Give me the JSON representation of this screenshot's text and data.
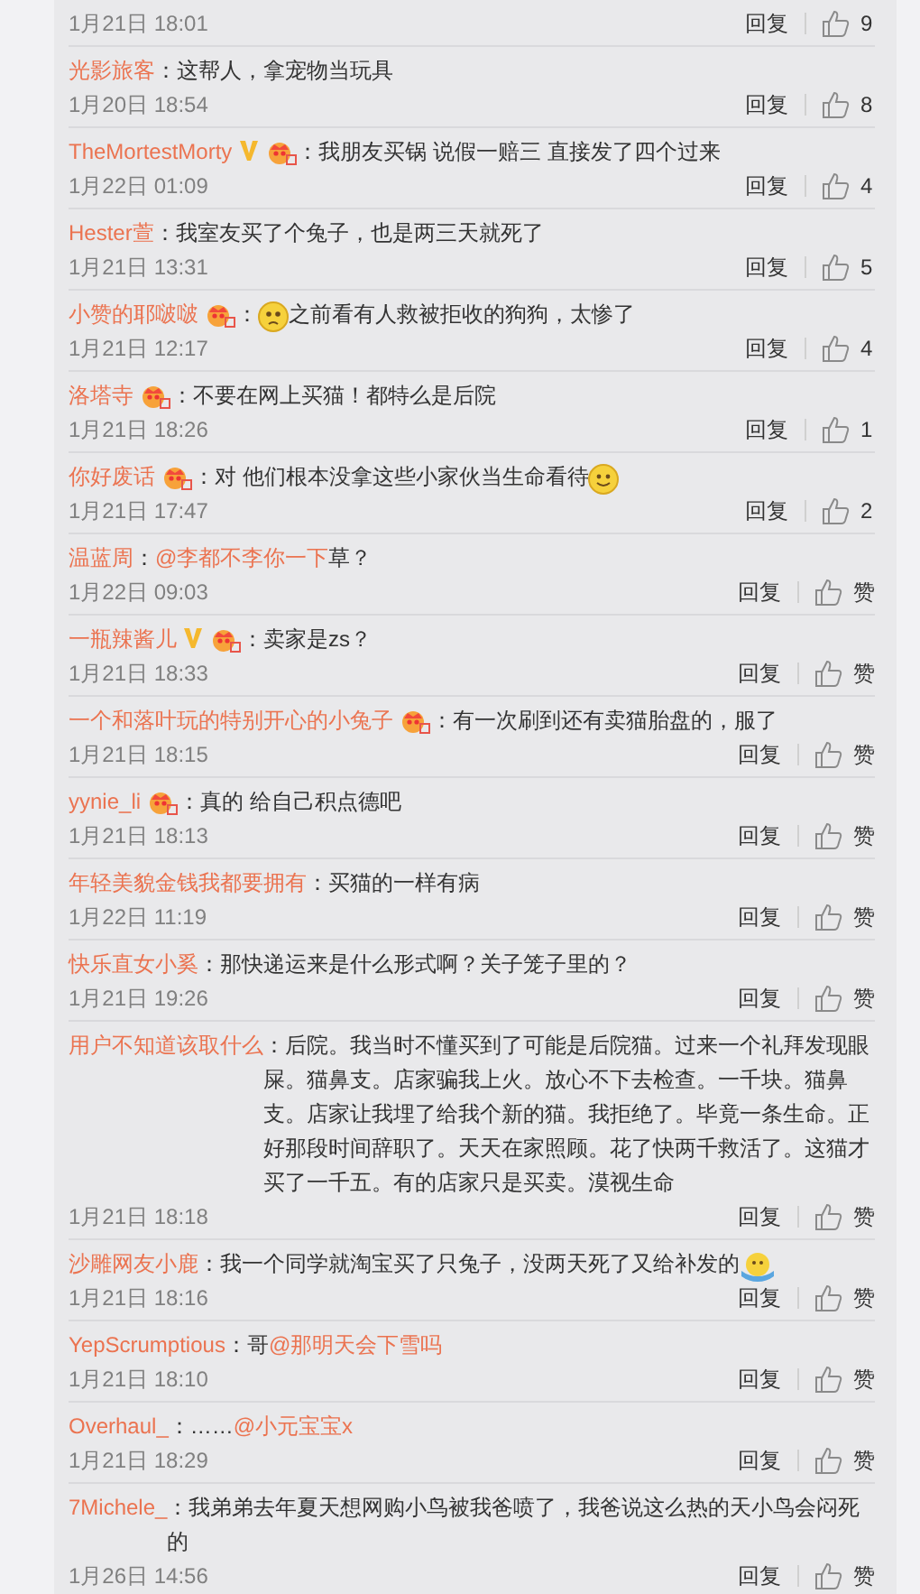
{
  "comments": [
    {
      "time": "1月21日 18:01",
      "reply": "回复",
      "likes": "9"
    },
    {
      "user": "光影旅客",
      "parts": [
        {
          "kind": "text",
          "text": "：这帮人，拿宠物当玩具"
        }
      ],
      "time": "1月20日 18:54",
      "reply": "回复",
      "likes": "8"
    },
    {
      "user": "TheMortestMorty",
      "badges": [
        {
          "kind": "verified"
        },
        {
          "kind": "vip"
        }
      ],
      "parts": [
        {
          "kind": "text",
          "text": "：我朋友买锅 说假一赔三 直接发了四个过来"
        }
      ],
      "time": "1月22日 01:09",
      "reply": "回复",
      "likes": "4"
    },
    {
      "user": "Hester萱",
      "parts": [
        {
          "kind": "text",
          "text": "：我室友买了个兔子，也是两三天就死了"
        }
      ],
      "time": "1月21日 13:31",
      "reply": "回复",
      "likes": "5"
    },
    {
      "user": "小赞的耶啵啵",
      "badges": [
        {
          "kind": "vip"
        }
      ],
      "parts": [
        {
          "kind": "text",
          "text": "："
        },
        {
          "kind": "sad_emoji"
        },
        {
          "kind": "text",
          "text": "之前看有人救被拒收的狗狗，太惨了"
        }
      ],
      "time": "1月21日 12:17",
      "reply": "回复",
      "likes": "4"
    },
    {
      "user": "洛塔寺",
      "badges": [
        {
          "kind": "vip"
        }
      ],
      "parts": [
        {
          "kind": "text",
          "text": "：不要在网上买猫！都特么是后院"
        }
      ],
      "time": "1月21日 18:26",
      "reply": "回复",
      "likes": "1"
    },
    {
      "user": "你好废话",
      "badges": [
        {
          "kind": "vip"
        }
      ],
      "parts": [
        {
          "kind": "text",
          "text": "：对 他们根本没拿这些小家伙当生命看待"
        },
        {
          "kind": "smile_emoji"
        }
      ],
      "time": "1月21日 17:47",
      "reply": "回复",
      "likes": "2"
    },
    {
      "user": "温蓝周",
      "parts": [
        {
          "kind": "text",
          "text": "："
        },
        {
          "kind": "mention",
          "text": "@李都不李你一下"
        },
        {
          "kind": "text",
          "text": " 草？"
        }
      ],
      "time": "1月22日 09:03",
      "reply": "回复",
      "likes": "赞"
    },
    {
      "user": "一瓶辣酱儿",
      "badges": [
        {
          "kind": "verified"
        },
        {
          "kind": "vip"
        }
      ],
      "parts": [
        {
          "kind": "text",
          "text": "：卖家是zs？"
        }
      ],
      "time": "1月21日 18:33",
      "reply": "回复",
      "likes": "赞"
    },
    {
      "user": "一个和落叶玩的特别开心的小兔子",
      "badges": [
        {
          "kind": "vip"
        }
      ],
      "parts": [
        {
          "kind": "text",
          "text": "：有一次刷到还有卖猫胎盘的，服了"
        }
      ],
      "time": "1月21日 18:15",
      "reply": "回复",
      "likes": "赞"
    },
    {
      "user": "yynie_li",
      "badges": [
        {
          "kind": "vip"
        }
      ],
      "parts": [
        {
          "kind": "text",
          "text": "：真的 给自己积点德吧"
        }
      ],
      "time": "1月21日 18:13",
      "reply": "回复",
      "likes": "赞"
    },
    {
      "user": "年轻美貌金钱我都要拥有",
      "parts": [
        {
          "kind": "text",
          "text": "：买猫的一样有病"
        }
      ],
      "time": "1月22日 11:19",
      "reply": "回复",
      "likes": "赞"
    },
    {
      "user": "快乐直女小奚",
      "parts": [
        {
          "kind": "text",
          "text": "：那快递运来是什么形式啊？关子笼子里的？"
        }
      ],
      "time": "1月21日 19:26",
      "reply": "回复",
      "likes": "赞"
    },
    {
      "user": "用户不知道该取什么",
      "parts": [
        {
          "kind": "text",
          "text": "：后院。我当时不懂买到了可能是后院猫。过来一个礼拜发现眼屎。猫鼻支。店家骗我上火。放心不下去检查。一千块。猫鼻支。店家让我埋了给我个新的猫。我拒绝了。毕竟一条生命。正好那段时间辞职了。天天在家照顾。花了快两千救活了。这猫才买了一千五。有的店家只是买卖。漠视生命"
        }
      ],
      "time": "1月21日 18:18",
      "reply": "回复",
      "likes": "赞"
    },
    {
      "user": "沙雕网友小鹿",
      "parts": [
        {
          "kind": "text",
          "text": "：我一个同学就淘宝买了只兔子，没两天死了又给补发的"
        },
        {
          "kind": "hug_emoji"
        }
      ],
      "time": "1月21日 18:16",
      "reply": "回复",
      "likes": "赞"
    },
    {
      "user": "YepScrumptious",
      "parts": [
        {
          "kind": "text",
          "text": "：哥"
        },
        {
          "kind": "mention",
          "text": "@那明天会下雪吗"
        }
      ],
      "time": "1月21日 18:10",
      "reply": "回复",
      "likes": "赞"
    },
    {
      "user": "Overhaul_",
      "parts": [
        {
          "kind": "text",
          "text": "：……"
        },
        {
          "kind": "mention",
          "text": "@小元宝宝x"
        }
      ],
      "time": "1月21日 18:29",
      "reply": "回复",
      "likes": "赞"
    },
    {
      "user": "7Michele_",
      "parts": [
        {
          "kind": "text",
          "text": "：我弟弟去年夏天想网购小鸟被我爸喷了，我爸说这么热的天小鸟会闷死的"
        }
      ],
      "time": "1月26日 14:56",
      "reply": "回复",
      "likes": "赞"
    }
  ]
}
